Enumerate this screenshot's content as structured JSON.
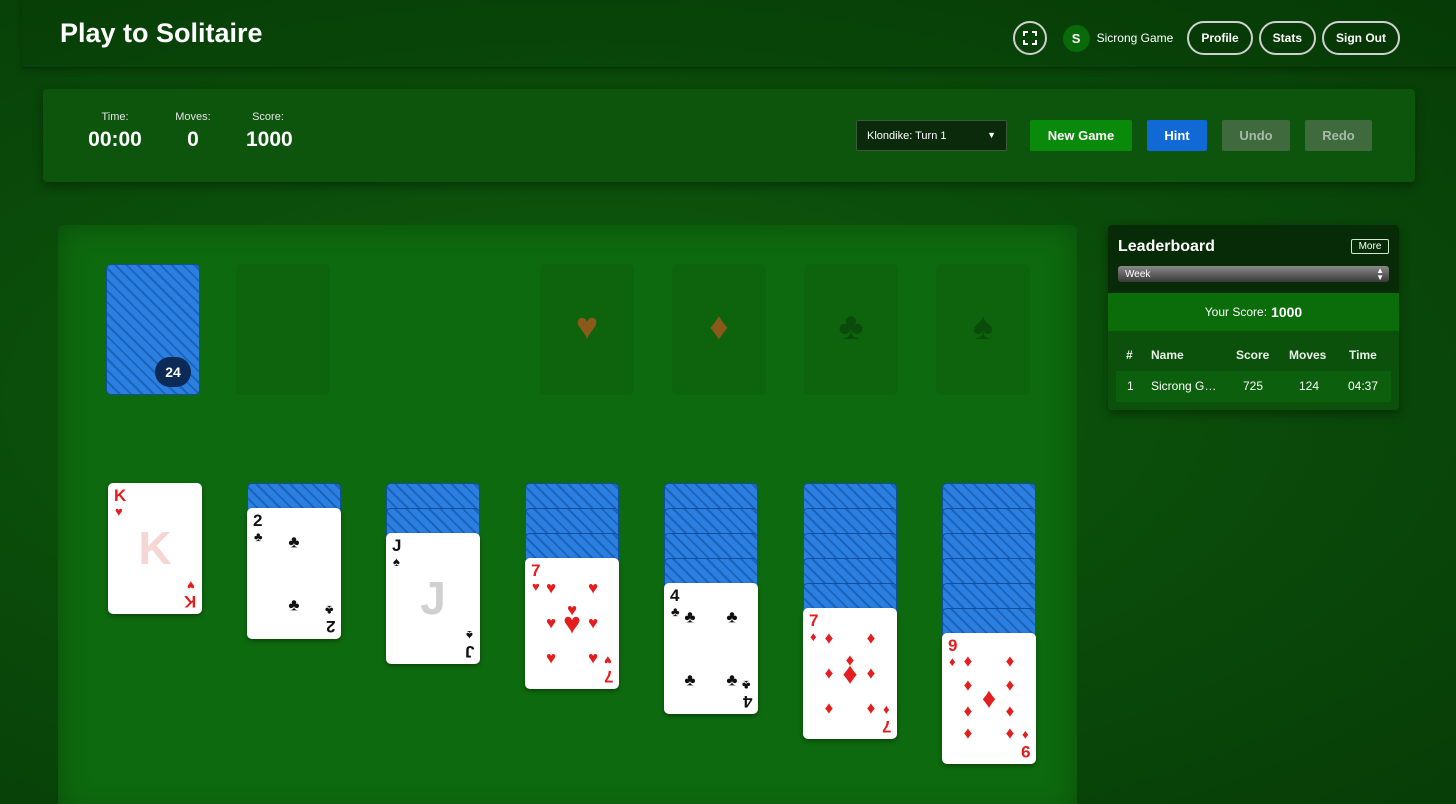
{
  "header": {
    "title": "Play to Solitaire",
    "avatar_initial": "S",
    "user_name": "Sicrong Game",
    "profile_label": "Profile",
    "stats_label": "Stats",
    "signout_label": "Sign Out"
  },
  "stats": {
    "time_label": "Time:",
    "time_value": "00:00",
    "moves_label": "Moves:",
    "moves_value": "0",
    "score_label": "Score:",
    "score_value": "1000"
  },
  "controls": {
    "game_mode": "Klondike: Turn 1",
    "new_game_label": "New Game",
    "hint_label": "Hint",
    "undo_label": "Undo",
    "redo_label": "Redo"
  },
  "colors": {
    "new_game": "#0a8a0a",
    "hint": "#1169d6",
    "disabled": "#3e6a3e",
    "red_suit": "#e41e1e"
  },
  "board": {
    "stock_count": "24",
    "foundations": [
      {
        "suit": "♥",
        "color": "#8a5a1a"
      },
      {
        "suit": "♦",
        "color": "#8a5a1a"
      },
      {
        "suit": "♣",
        "color": "#0a4a0a"
      },
      {
        "suit": "♠",
        "color": "#0a4a0a"
      }
    ],
    "tableau": [
      {
        "hidden": 0,
        "rank": "K",
        "suit": "♥",
        "color": "red"
      },
      {
        "hidden": 1,
        "rank": "2",
        "suit": "♣",
        "color": "blk"
      },
      {
        "hidden": 2,
        "rank": "J",
        "suit": "♠",
        "color": "blk"
      },
      {
        "hidden": 3,
        "rank": "7",
        "suit": "♥",
        "color": "red"
      },
      {
        "hidden": 4,
        "rank": "4",
        "suit": "♣",
        "color": "blk"
      },
      {
        "hidden": 5,
        "rank": "7",
        "suit": "♦",
        "color": "red"
      },
      {
        "hidden": 6,
        "rank": "9",
        "suit": "♦",
        "color": "red"
      }
    ]
  },
  "leaderboard": {
    "title": "Leaderboard",
    "more_label": "More",
    "period": "Week",
    "your_score_label": "Your Score:",
    "your_score_value": "1000",
    "columns": [
      "#",
      "Name",
      "Score",
      "Moves",
      "Time"
    ],
    "rows": [
      [
        "1",
        "Sicrong G…",
        "725",
        "124",
        "04:37"
      ]
    ]
  }
}
